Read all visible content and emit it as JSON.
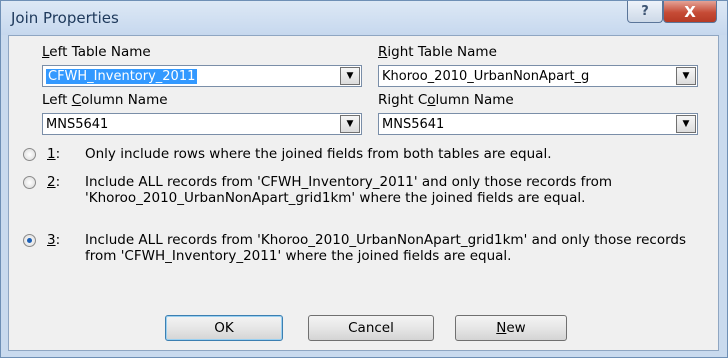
{
  "window": {
    "title": "Join Properties",
    "help_glyph": "?",
    "close_glyph": "X"
  },
  "left_table": {
    "label_prefix": "",
    "label_accel": "L",
    "label_rest": "eft Table Name",
    "value": "CFWH_Inventory_2011"
  },
  "right_table": {
    "label_prefix": "",
    "label_accel": "R",
    "label_rest": "ight Table Name",
    "value": "Khoroo_2010_UrbanNonApart_g"
  },
  "left_column": {
    "label_prefix": "Left ",
    "label_accel": "C",
    "label_rest": "olumn Name",
    "value": "MNS5641"
  },
  "right_column": {
    "label_prefix": "Right C",
    "label_accel": "o",
    "label_rest": "lumn Name",
    "value": "MNS5641"
  },
  "dropdown_glyph": "▼",
  "options": [
    {
      "accel": "1",
      "key_suffix": ":",
      "text": "Only include rows where the joined fields from both tables are equal.",
      "checked": false
    },
    {
      "accel": "2",
      "key_suffix": ":",
      "text": "Include ALL records from 'CFWH_Inventory_2011' and only those records from 'Khoroo_2010_UrbanNonApart_grid1km' where the joined fields are equal.",
      "checked": false
    },
    {
      "accel": "3",
      "key_suffix": ":",
      "text": "Include ALL records from 'Khoroo_2010_UrbanNonApart_grid1km' and only those records from 'CFWH_Inventory_2011' where the joined fields are equal.",
      "checked": true
    }
  ],
  "buttons": {
    "ok": "OK",
    "cancel": "Cancel",
    "new_accel": "N",
    "new_rest": "ew"
  }
}
